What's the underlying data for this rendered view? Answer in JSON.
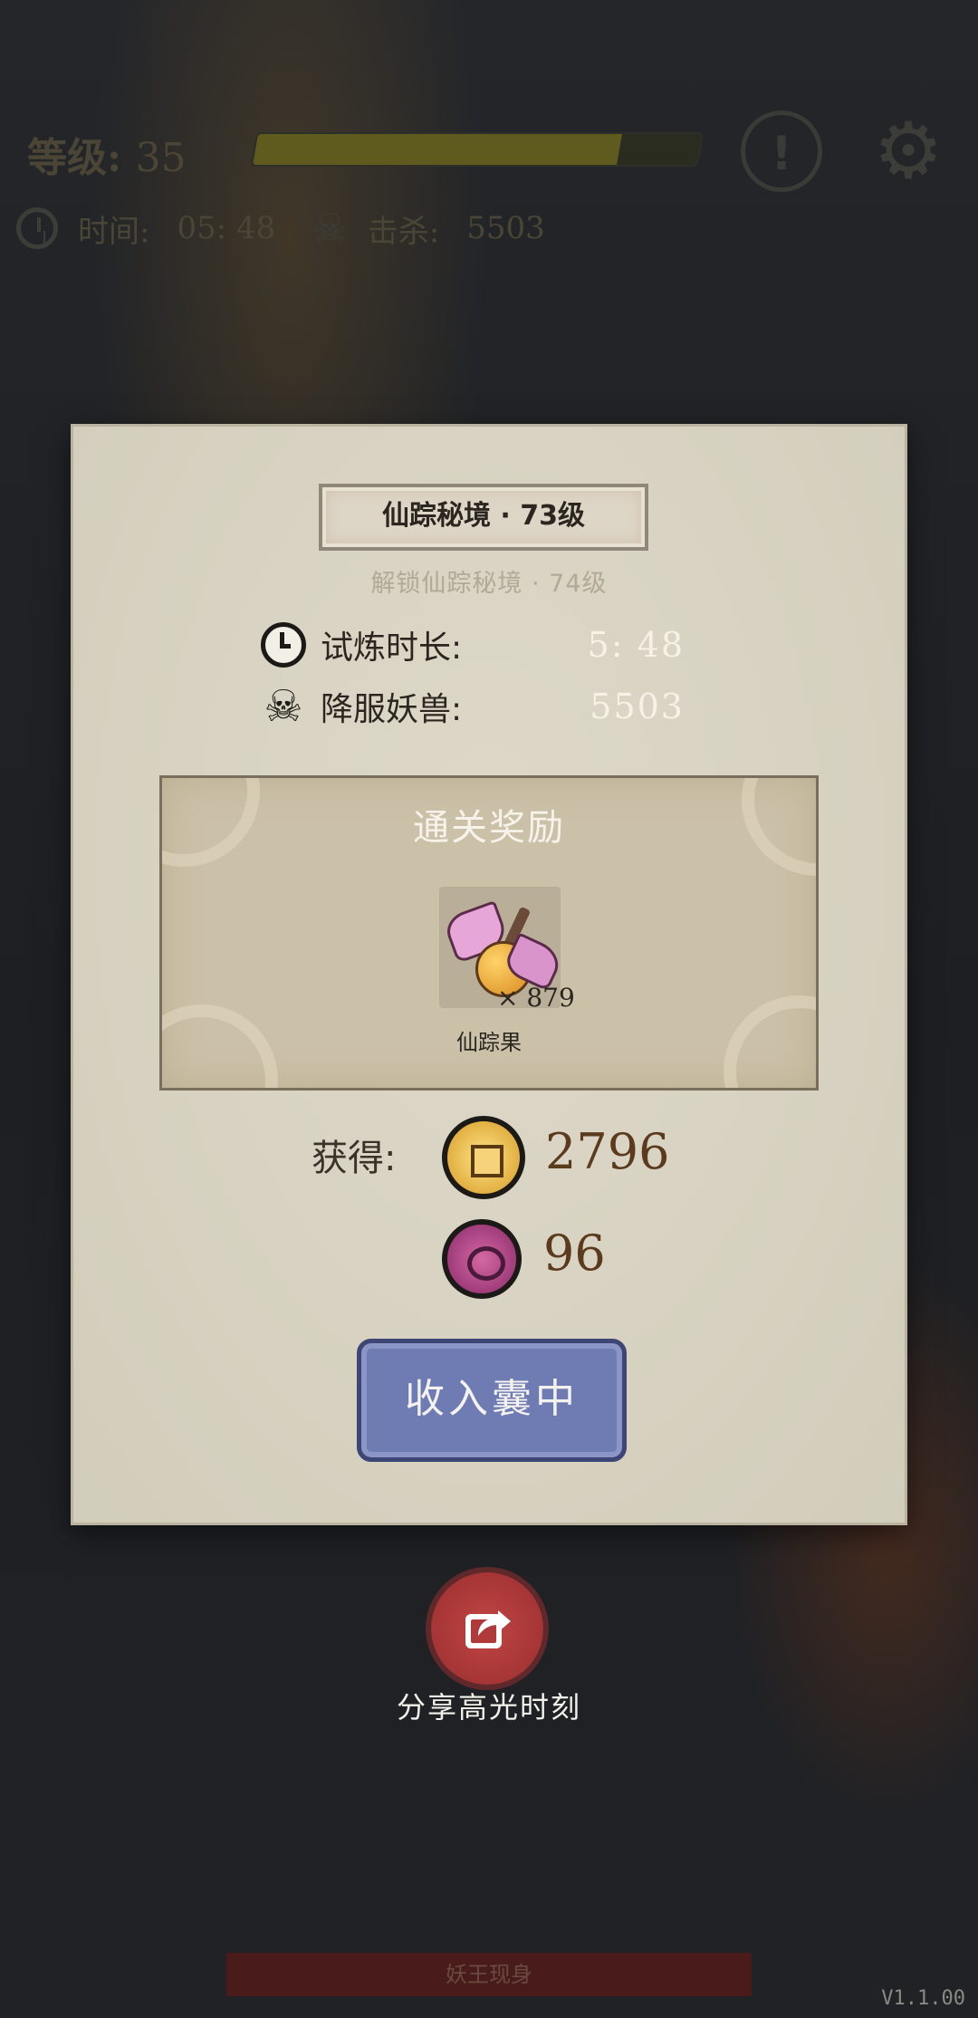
{
  "hud": {
    "level_label": "等级:",
    "level_value": "35",
    "time_label": "时间:",
    "time_value": "05: 48",
    "kills_label": "击杀:",
    "kills_value": "5503",
    "progress": 0.82,
    "icons": {
      "alert": "exclamation-icon",
      "settings": "gear-icon",
      "clock": "clock-icon",
      "kills": "skull-icon"
    }
  },
  "dialog": {
    "title": "仙踪秘境 · 73级",
    "subtitle": "解锁仙踪秘境 · 74级",
    "stats": [
      {
        "label": "试炼时长:",
        "value": "5: 48",
        "icon": "clock-icon"
      },
      {
        "label": "降服妖兽:",
        "value": "5503",
        "icon": "skull-icon"
      }
    ],
    "reward": {
      "title": "通关奖励",
      "item": {
        "name": "仙踪果",
        "count": "× 879",
        "icon": "fairy-fruit-icon"
      }
    },
    "gain_label": "获得:",
    "currencies": [
      {
        "icon": "gold-coin-icon",
        "amount": "2796"
      },
      {
        "icon": "spirit-orb-icon",
        "amount": "96"
      }
    ],
    "collect_button": "收入囊中"
  },
  "share": {
    "label": "分享高光时刻",
    "icon": "share-icon"
  },
  "footer": {
    "boss_banner": "妖王现身",
    "version": "V1.1.00"
  },
  "colors": {
    "panel": "#d8d3c2",
    "button": "#6f7bb3",
    "share": "#b03a3a",
    "amount": "#5b3a1e"
  }
}
